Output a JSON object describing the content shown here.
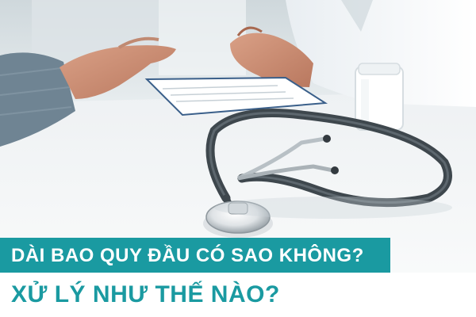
{
  "banner": {
    "headline": "DÀI BAO QUY ĐẦU CÓ SAO KHÔNG?",
    "subheadline": "XỬ LÝ NHƯ THẾ NÀO?",
    "accent_color": "#1a9aa1",
    "text_on_accent_color": "#ffffff"
  },
  "photo": {
    "subject_icons": [
      "stethoscope-icon",
      "pill-bottle-icon",
      "clipboard-icon"
    ]
  }
}
